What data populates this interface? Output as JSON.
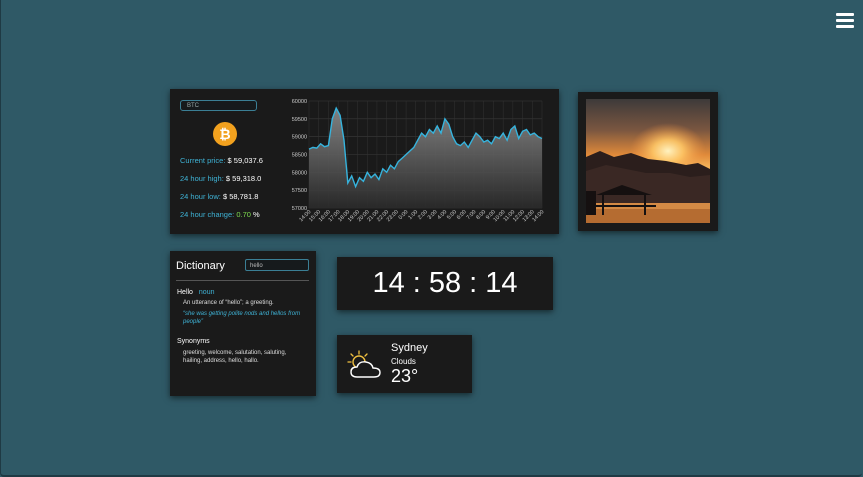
{
  "menu": {
    "icon": "hamburger-icon"
  },
  "btc_widget": {
    "ticker_input": "BTC",
    "coin_symbol": "₿",
    "current_price_label": "Current price:",
    "current_price": "$ 59,037.6",
    "high_label": "24 hour high:",
    "high": "$ 59,318.0",
    "low_label": "24 hour low:",
    "low": "$ 58,781.8",
    "change_label": "24 hour change:",
    "change_value": "0.70",
    "change_unit": "%"
  },
  "chart_data": {
    "type": "area",
    "title": "",
    "xlabel": "",
    "ylabel": "",
    "ylim": [
      57000,
      60000
    ],
    "yticks": [
      "57000",
      "57500",
      "58000",
      "58500",
      "59000",
      "59500",
      "60000"
    ],
    "xticks": [
      "14:00",
      "15:00",
      "16:00",
      "17:00",
      "18:00",
      "19:00",
      "20:00",
      "21:00",
      "22:00",
      "23:00",
      "0:00",
      "1:00",
      "2:00",
      "3:00",
      "4:00",
      "5:00",
      "6:00",
      "7:00",
      "8:00",
      "9:00",
      "10:00",
      "11:00",
      "12:00",
      "13:00",
      "14:00"
    ],
    "grid": true,
    "colors": {
      "line": "#36b4de",
      "fill_top": "#8c8c8c",
      "fill_bottom": "#2a2a2a"
    },
    "series": [
      {
        "values": [
          58650,
          58700,
          58680,
          58800,
          58720,
          58750,
          59500,
          59800,
          59600,
          58900,
          57700,
          57900,
          57600,
          57850,
          57750,
          58000,
          57850,
          57950,
          57800,
          58100,
          58000,
          58200,
          58100,
          58300,
          58400,
          58500,
          58600,
          58700,
          58900,
          59100,
          59000,
          59200,
          59100,
          59300,
          59100,
          59500,
          59350,
          59000,
          58800,
          58750,
          58850,
          58700,
          58900,
          59100,
          59000,
          58850,
          58900,
          58800,
          59000,
          58950,
          59100,
          58900,
          59200,
          59300,
          58950,
          59150,
          59200,
          59050,
          59100,
          59000,
          58950
        ]
      }
    ]
  },
  "photo": {
    "icon": "sunset-photo",
    "alt": ""
  },
  "dictionary": {
    "title": "Dictionary",
    "search_value": "hello",
    "word": "Hello",
    "part_of_speech": "noun",
    "definition": "An utterance of “hello”; a greeting.",
    "example": "“she was getting polite nods and hellos from people”",
    "synonyms_label": "Synonyms",
    "synonyms": "greeting, welcome, salutation, saluting, hailing, address, hello, hallo."
  },
  "clock": {
    "time": "14 : 58 : 14"
  },
  "weather": {
    "icon": "partly-cloudy-icon",
    "city": "Sydney",
    "condition": "Clouds",
    "temperature": "23°"
  },
  "colors": {
    "background": "#2f5966",
    "panel": "#1a1a1a",
    "accent": "#3fb3d6",
    "bitcoin": "#f2a11e",
    "positive": "#7ddc4f"
  }
}
